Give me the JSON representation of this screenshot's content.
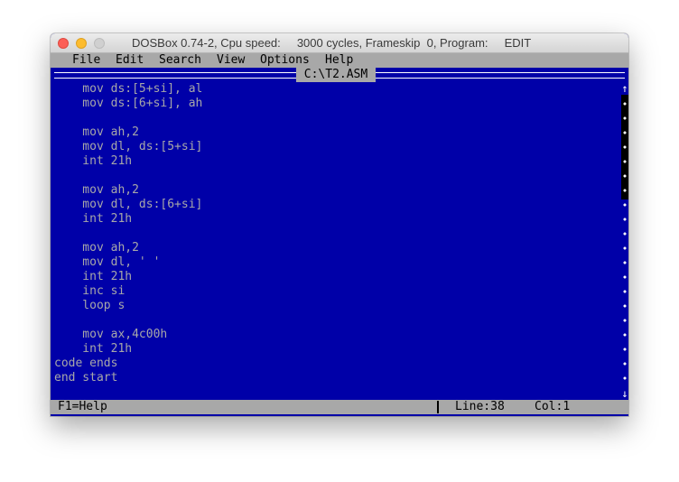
{
  "window": {
    "title": "DOSBox 0.74-2, Cpu speed:     3000 cycles, Frameskip  0, Program:     EDIT"
  },
  "menu": {
    "items": [
      "File",
      "Edit",
      "Search",
      "View",
      "Options",
      "Help"
    ]
  },
  "editor": {
    "filename": "C:\\T2.ASM",
    "lines": [
      "    mov ds:[5+si], al",
      "    mov ds:[6+si], ah",
      "",
      "    mov ah,2",
      "    mov dl, ds:[5+si]",
      "    int 21h",
      "",
      "    mov ah,2",
      "    mov dl, ds:[6+si]",
      "    int 21h",
      "",
      "    mov ah,2",
      "    mov dl, ' '",
      "    int 21h",
      "    inc si",
      "    loop s",
      "",
      "    mov ax,4c00h",
      "    int 21h",
      "code ends",
      "end start",
      ""
    ]
  },
  "scrollbar": {
    "up_icon": "arrow-up-icon",
    "down_icon": "arrow-down-icon",
    "up_glyph": "↑",
    "down_glyph": "↓"
  },
  "status": {
    "help": "F1=Help",
    "line_label": "Line:",
    "line_value": "38",
    "col_label": "Col:",
    "col_value": "1"
  },
  "colors": {
    "background": "#0000a8",
    "text": "#a8a8a8",
    "bars": "#a8a8a8"
  }
}
